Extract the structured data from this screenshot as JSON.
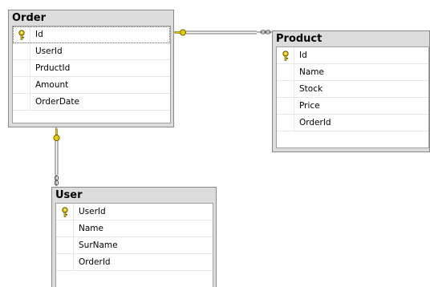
{
  "tables": {
    "order": {
      "title": "Order",
      "columns": [
        {
          "name": "Id",
          "key": true
        },
        {
          "name": "UserId",
          "key": false
        },
        {
          "name": "PrductId",
          "key": false
        },
        {
          "name": "Amount",
          "key": false
        },
        {
          "name": "OrderDate",
          "key": false
        }
      ]
    },
    "product": {
      "title": "Product",
      "columns": [
        {
          "name": "Id",
          "key": true
        },
        {
          "name": "Name",
          "key": false
        },
        {
          "name": "Stock",
          "key": false
        },
        {
          "name": "Price",
          "key": false
        },
        {
          "name": "OrderId",
          "key": false
        }
      ]
    },
    "user": {
      "title": "User",
      "columns": [
        {
          "name": "UserId",
          "key": true
        },
        {
          "name": "Name",
          "key": false
        },
        {
          "name": "SurName",
          "key": false
        },
        {
          "name": "OrderId",
          "key": false
        }
      ]
    }
  },
  "relationships": [
    {
      "from": "Order",
      "to": "Product",
      "one_end": "key-icon",
      "many_end": "infinity-icon"
    },
    {
      "from": "Order",
      "to": "User",
      "one_end": "key-icon",
      "many_end": "infinity-icon"
    }
  ],
  "colors": {
    "key": "#e8c800",
    "line": "#6e6e6e",
    "header": "#dcdcdc"
  }
}
